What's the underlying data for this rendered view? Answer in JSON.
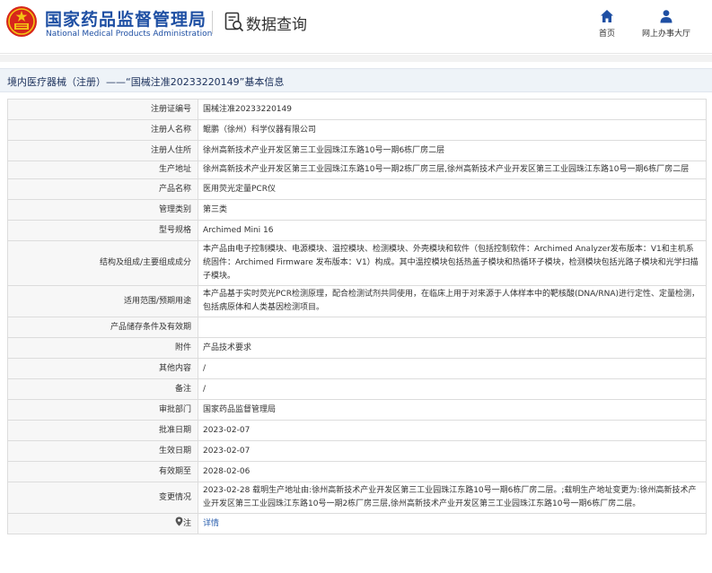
{
  "header": {
    "brand_cn": "国家药品监督管理局",
    "brand_en": "National Medical Products Administration",
    "section_title": "数据查询",
    "nav": [
      {
        "label": "首页",
        "icon": "home-icon"
      },
      {
        "label": "网上办事大厅",
        "icon": "user-icon"
      }
    ]
  },
  "breadcrumb": {
    "text": "境内医疗器械（注册）——“国械注准20233220149”基本信息"
  },
  "detail": {
    "rows": [
      {
        "key": "注册证编号",
        "value": "国械注准20233220149"
      },
      {
        "key": "注册人名称",
        "value": "鲲鹏（徐州）科学仪器有限公司"
      },
      {
        "key": "注册人住所",
        "value": "徐州高新技术产业开发区第三工业园珠江东路10号一期6栋厂房二层"
      },
      {
        "key": "生产地址",
        "value": "徐州高新技术产业开发区第三工业园珠江东路10号一期2栋厂房三层,徐州高新技术产业开发区第三工业园珠江东路10号一期6栋厂房二层"
      },
      {
        "key": "产品名称",
        "value": "医用荧光定量PCR仪"
      },
      {
        "key": "管理类别",
        "value": "第三类"
      },
      {
        "key": "型号规格",
        "value": "Archimed Mini 16"
      },
      {
        "key": "结构及组成/主要组成成分",
        "value": "本产品由电子控制模块、电源模块、温控模块、检测模块、外壳模块和软件（包括控制软件：Archimed Analyzer发布版本：V1和主机系统固件：Archimed Firmware 发布版本：V1）构成。其中温控模块包括热盖子模块和热循环子模块，检测模块包括光路子模块和光学扫描子模块。"
      },
      {
        "key": "适用范围/预期用途",
        "value": "本产品基于实时荧光PCR检测原理，配合检测试剂共同使用，在临床上用于对来源于人体样本中的靶核酸(DNA/RNA)进行定性、定量检测，包括病原体和人类基因检测项目。"
      },
      {
        "key": "产品储存条件及有效期",
        "value": ""
      },
      {
        "key": "附件",
        "value": "产品技术要求"
      },
      {
        "key": "其他内容",
        "value": "/"
      },
      {
        "key": "备注",
        "value": "/"
      },
      {
        "key": "审批部门",
        "value": "国家药品监督管理局"
      },
      {
        "key": "批准日期",
        "value": "2023-02-07"
      },
      {
        "key": "生效日期",
        "value": "2023-02-07"
      },
      {
        "key": "有效期至",
        "value": "2028-02-06"
      },
      {
        "key": "变更情况",
        "value": "2023-02-28 载明生产地址由:徐州高新技术产业开发区第三工业园珠江东路10号一期6栋厂房二层。;载明生产地址变更为:徐州高新技术产业开发区第三工业园珠江东路10号一期2栋厂房三层,徐州高新技术产业开发区第三工业园珠江东路10号一期6栋厂房二层。"
      }
    ],
    "notice": {
      "key": "注",
      "icon": "pin-icon",
      "link_label": "详情"
    }
  },
  "colors": {
    "brand_blue": "#1e4fa3",
    "emblem_red": "#d7261b",
    "emblem_gold": "#f3c414",
    "link_blue": "#2b5fae",
    "key_bg": "#f7f7f7",
    "crumb_bg": "#eef3f8"
  }
}
